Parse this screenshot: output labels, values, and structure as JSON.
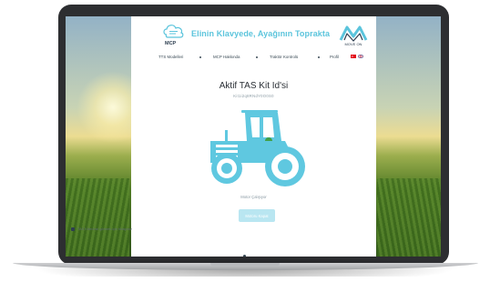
{
  "header": {
    "title": "Elinin Klavyede, Ayağının Toprakta",
    "logo_left_text": "MCP",
    "logo_right_text": "MOVE ON"
  },
  "nav": {
    "items": [
      {
        "label": "TTS Modelleri"
      },
      {
        "label": "MCP Hakkında"
      },
      {
        "label": "Traktör Kontrolü"
      },
      {
        "label": "Profil"
      }
    ]
  },
  "main": {
    "title": "Aktif TAS Kit Id'si",
    "kit_id": "Kit1i2q8RNdY0O0S0",
    "status": "Motor Çalışıyor",
    "button_label": "Motoru Kapat"
  },
  "footer": {
    "checkbox_label": "TAS Kitlerinizi görmek için tıklayınız"
  },
  "colors": {
    "accent": "#5bc4dc",
    "tractor": "#5fc8e0",
    "button": "#b9e6f1"
  }
}
